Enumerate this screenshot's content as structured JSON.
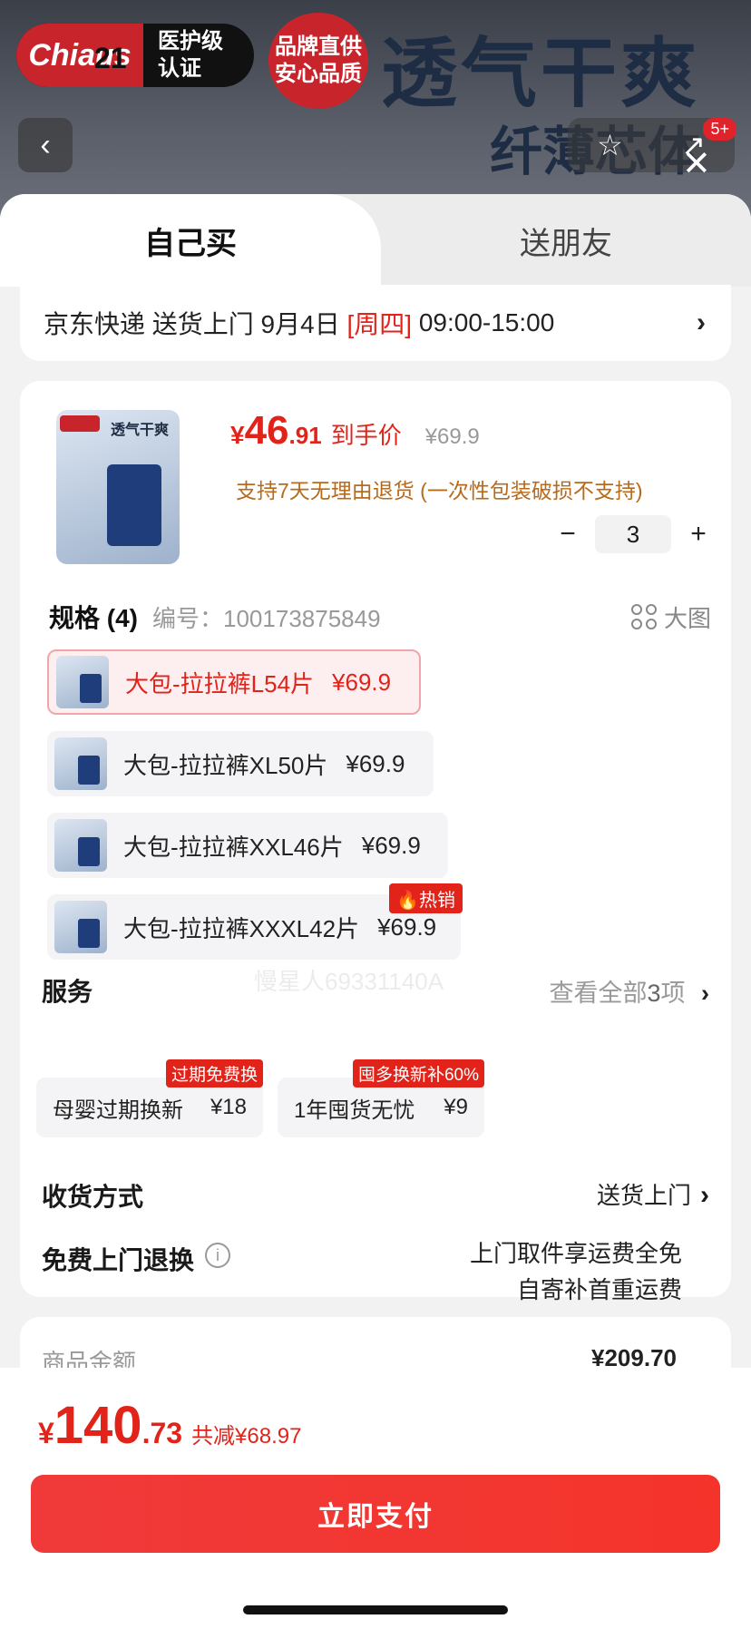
{
  "backdrop": {
    "brand_logo": "Chiaus",
    "brand_badge": "医护级\n认证",
    "promo_badge": "品牌直供\n安心品质",
    "title": "透气干爽",
    "subtitle": "纤薄芯体",
    "status_time": "21",
    "cart_count": "5+"
  },
  "tabs": {
    "self": "自己买",
    "gift": "送朋友"
  },
  "delivery": {
    "prefix": "京东快递 送货上门 9月4日 ",
    "weekday": "[周四]",
    "time": " 09:00-15:00"
  },
  "product": {
    "yen": "¥",
    "price_int": "46",
    "price_dec": ".91",
    "price_tag": "到手价",
    "orig_price": "¥69.9",
    "return_note": "支持7天无理由退货 (一次性包装破损不支持)",
    "qty_minus": "−",
    "qty": "3",
    "qty_plus": "+",
    "thumb_title": "透气干爽"
  },
  "spec": {
    "title": "规格 (4)",
    "code": "编号：100173875849",
    "big_view": "大图",
    "items": [
      {
        "name": "大包-拉拉裤L54片",
        "price": "¥69.9"
      },
      {
        "name": "大包-拉拉裤XL50片",
        "price": "¥69.9"
      },
      {
        "name": "大包-拉拉裤XXL46片",
        "price": "¥69.9"
      },
      {
        "name": "大包-拉拉裤XXXL42片",
        "price": "¥69.9",
        "tag": "热销"
      }
    ]
  },
  "services": {
    "title": "服务",
    "more_prefix": "查看全部",
    "more_count": "3",
    "more_suffix": "项",
    "items": [
      {
        "name": "母婴过期换新",
        "price": "¥18",
        "tag": "过期免费换"
      },
      {
        "name": "1年囤货无忧",
        "price": "¥9",
        "tag": "囤多换新补60%"
      }
    ]
  },
  "receive": {
    "label": "收货方式",
    "value": "送货上门"
  },
  "free_return": {
    "label": "免费上门退换",
    "line1": "上门取件享运费全免",
    "line2": "自寄补首重运费"
  },
  "summary": {
    "label": "商品金额",
    "value": "¥209.70"
  },
  "total": {
    "yen": "¥",
    "int": "140",
    "dec": ".73",
    "save": "共减¥68.97"
  },
  "pay_button": "立即支付",
  "watermark": "慢星人69331140A",
  "colors": {
    "accent": "#e2231a",
    "orange": "#b86a1c"
  }
}
